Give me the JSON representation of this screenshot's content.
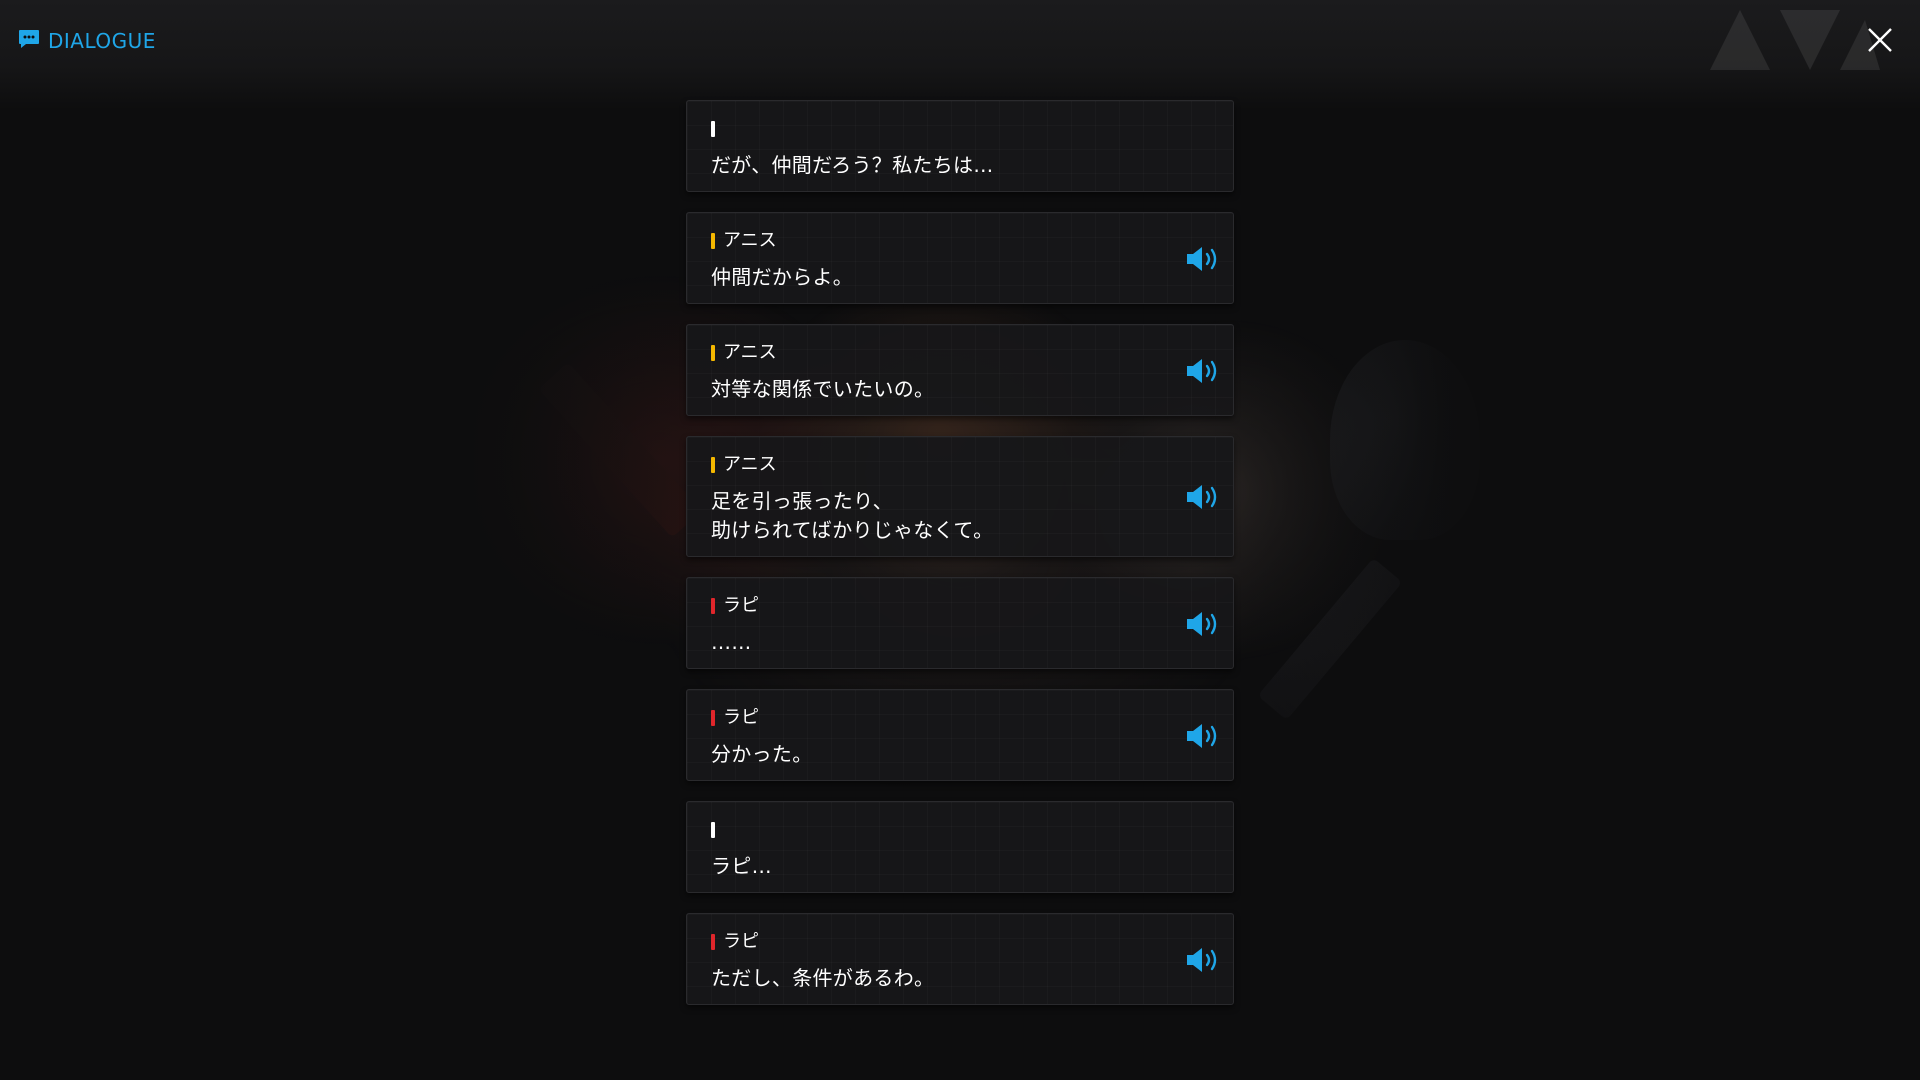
{
  "header": {
    "title": "DIALOGUE",
    "title_icon": "chat-bubble-icon",
    "close_icon": "close-icon"
  },
  "colors": {
    "accent": "#1fa6e8",
    "background": "#0d0d0e",
    "card": "#171719",
    "speaker_white": "#ffffff",
    "speaker_anis": "#f5b800",
    "speaker_rapi": "#e0262b"
  },
  "dialogue": [
    {
      "speaker": "",
      "speaker_color": "#ffffff",
      "text": "だが、仲間だろう？私たちは…",
      "has_voice": false
    },
    {
      "speaker": "アニス",
      "speaker_color": "#f5b800",
      "text": "仲間だからよ。",
      "has_voice": true
    },
    {
      "speaker": "アニス",
      "speaker_color": "#f5b800",
      "text": "対等な関係でいたいの。",
      "has_voice": true
    },
    {
      "speaker": "アニス",
      "speaker_color": "#f5b800",
      "text": "足を引っ張ったり、",
      "text_line2": "助けられてばかりじゃなくて。",
      "has_voice": true
    },
    {
      "speaker": "ラピ",
      "speaker_color": "#e0262b",
      "text": "……",
      "has_voice": true
    },
    {
      "speaker": "ラピ",
      "speaker_color": "#e0262b",
      "text": "分かった。",
      "has_voice": true
    },
    {
      "speaker": "",
      "speaker_color": "#ffffff",
      "text": "ラピ…",
      "has_voice": false
    },
    {
      "speaker": "ラピ",
      "speaker_color": "#e0262b",
      "text": "ただし、条件があるわ。",
      "has_voice": true
    }
  ]
}
